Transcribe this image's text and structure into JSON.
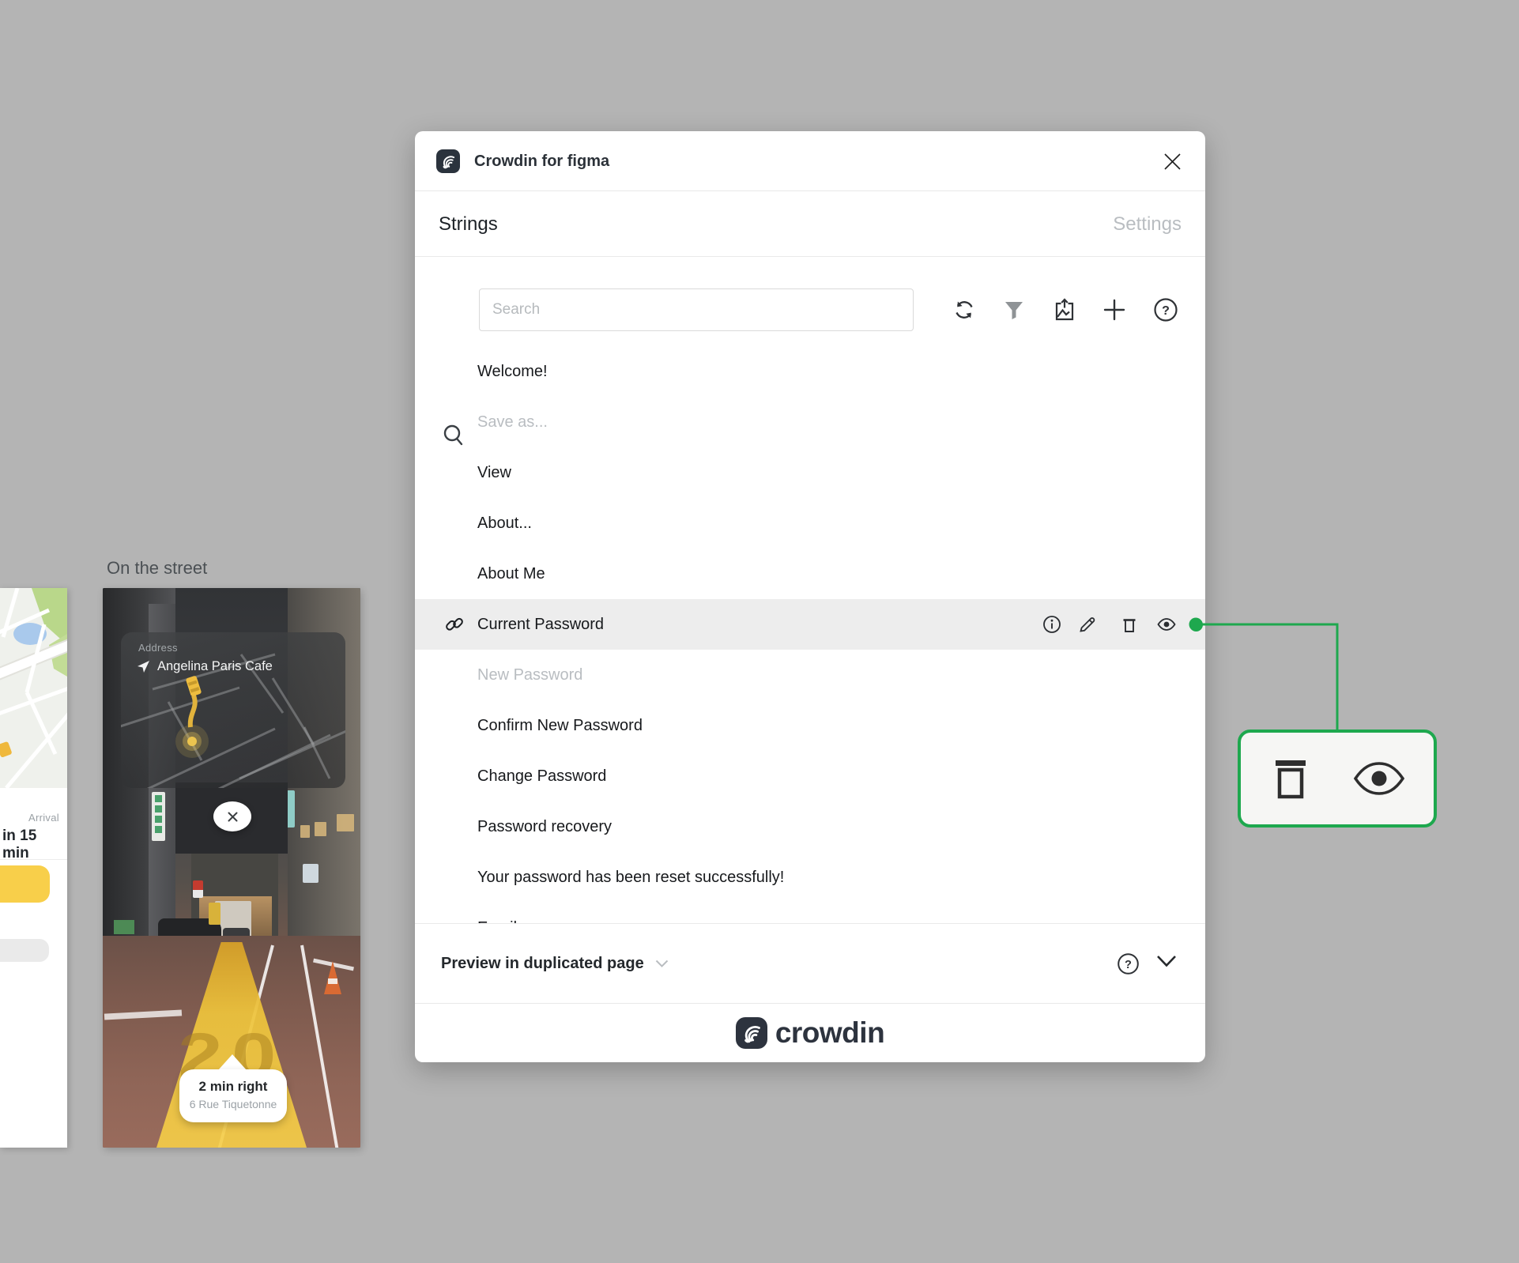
{
  "canvas": {
    "background": "#b4b4b4",
    "artboard_label": "On the street"
  },
  "plugin": {
    "title": "Crowdin for figma",
    "tabs": {
      "strings": "Strings",
      "settings": "Settings"
    },
    "toolbar": {
      "search_placeholder": "Search",
      "icons": [
        "search-icon",
        "sync-icon",
        "filter-icon",
        "export-image-icon",
        "add-icon",
        "help-icon"
      ]
    },
    "strings": {
      "items": [
        {
          "label": "Welcome!",
          "state": "normal"
        },
        {
          "label": "Save as...",
          "state": "muted"
        },
        {
          "label": "View",
          "state": "normal"
        },
        {
          "label": "About...",
          "state": "normal"
        },
        {
          "label": "About Me",
          "state": "normal"
        },
        {
          "label": "Current Password",
          "state": "selected"
        },
        {
          "label": "New Password",
          "state": "muted"
        },
        {
          "label": "Confirm New Password",
          "state": "normal"
        },
        {
          "label": "Change Password",
          "state": "normal"
        },
        {
          "label": "Password recovery",
          "state": "normal"
        },
        {
          "label": "Your password has been reset successfully!",
          "state": "normal"
        },
        {
          "label": "Email",
          "state": "clipped"
        }
      ],
      "selected_row_icons": [
        "link-icon",
        "info-icon",
        "edit-icon",
        "delete-icon",
        "preview-eye-icon"
      ],
      "selected_row_highlight": "#ededed"
    },
    "preview_bar": {
      "label": "Preview in duplicated page"
    },
    "footer": {
      "brand": "crowdin"
    }
  },
  "callout": {
    "accent": "#1ea84e",
    "icons": [
      "delete-icon",
      "preview-eye-icon"
    ]
  },
  "street_view": {
    "address_label": "Address",
    "address_value": "Angelina Paris Cafe",
    "road_marking": "20",
    "direction_title": "2 min right",
    "direction_subtitle": "6 Rue Tiquetonne"
  },
  "map_view": {
    "arrival_label": "Arrival",
    "arrival_value": "in 15 min"
  }
}
